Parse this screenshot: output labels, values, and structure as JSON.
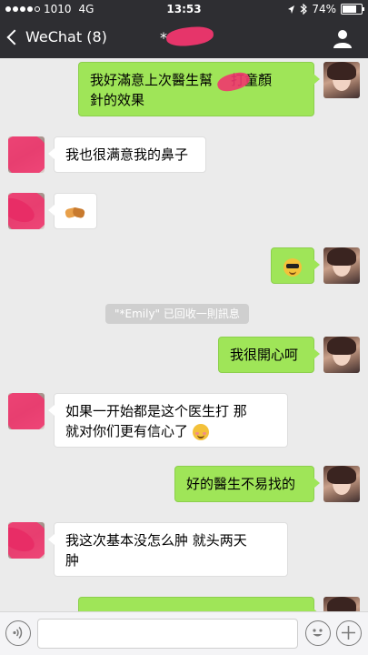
{
  "status_bar": {
    "carrier": "1010",
    "network": "4G",
    "time": "13:53",
    "battery": "74%",
    "battery_level": 0.74
  },
  "nav": {
    "back_label": "WeChat (8)",
    "title": "*"
  },
  "messages": [
    {
      "side": "out",
      "text": "我好滿意上次醫生幫"
    },
    {
      "side": "out",
      "text": "打童顏"
    },
    {
      "side": "out",
      "text": "針的效果"
    },
    {
      "side": "in",
      "text": "我也很满意我的鼻子"
    },
    {
      "side": "in",
      "emoji": "handshake"
    },
    {
      "side": "out",
      "emoji": "smiling-face-with-sunglasses"
    },
    {
      "side": "system",
      "text": "\"*Emily\" 已回收一則訊息"
    },
    {
      "side": "out",
      "text": "我很開心呵"
    },
    {
      "side": "in",
      "text": "如果一开始都是这个医生打 那"
    },
    {
      "side": "in",
      "text": "就对你们更有信心了",
      "emoji": "blushing-face"
    },
    {
      "side": "out",
      "text": "好的醫生不易找的"
    },
    {
      "side": "in",
      "text": "我这次基本没怎么肿 就头两天"
    },
    {
      "side": "in",
      "text": "肿"
    }
  ],
  "input": {
    "placeholder": ""
  },
  "icons": {
    "voice": "voice-icon",
    "emoji": "emoji-icon",
    "plus": "plus-icon",
    "profile": "profile-icon",
    "back": "chevron-left-icon"
  },
  "colors": {
    "nav_bg": "#2e2e32",
    "chat_bg": "#ebebeb",
    "outgoing_bubble": "#9fe558",
    "incoming_bubble": "#ffffff",
    "redaction": "#f0366e"
  }
}
